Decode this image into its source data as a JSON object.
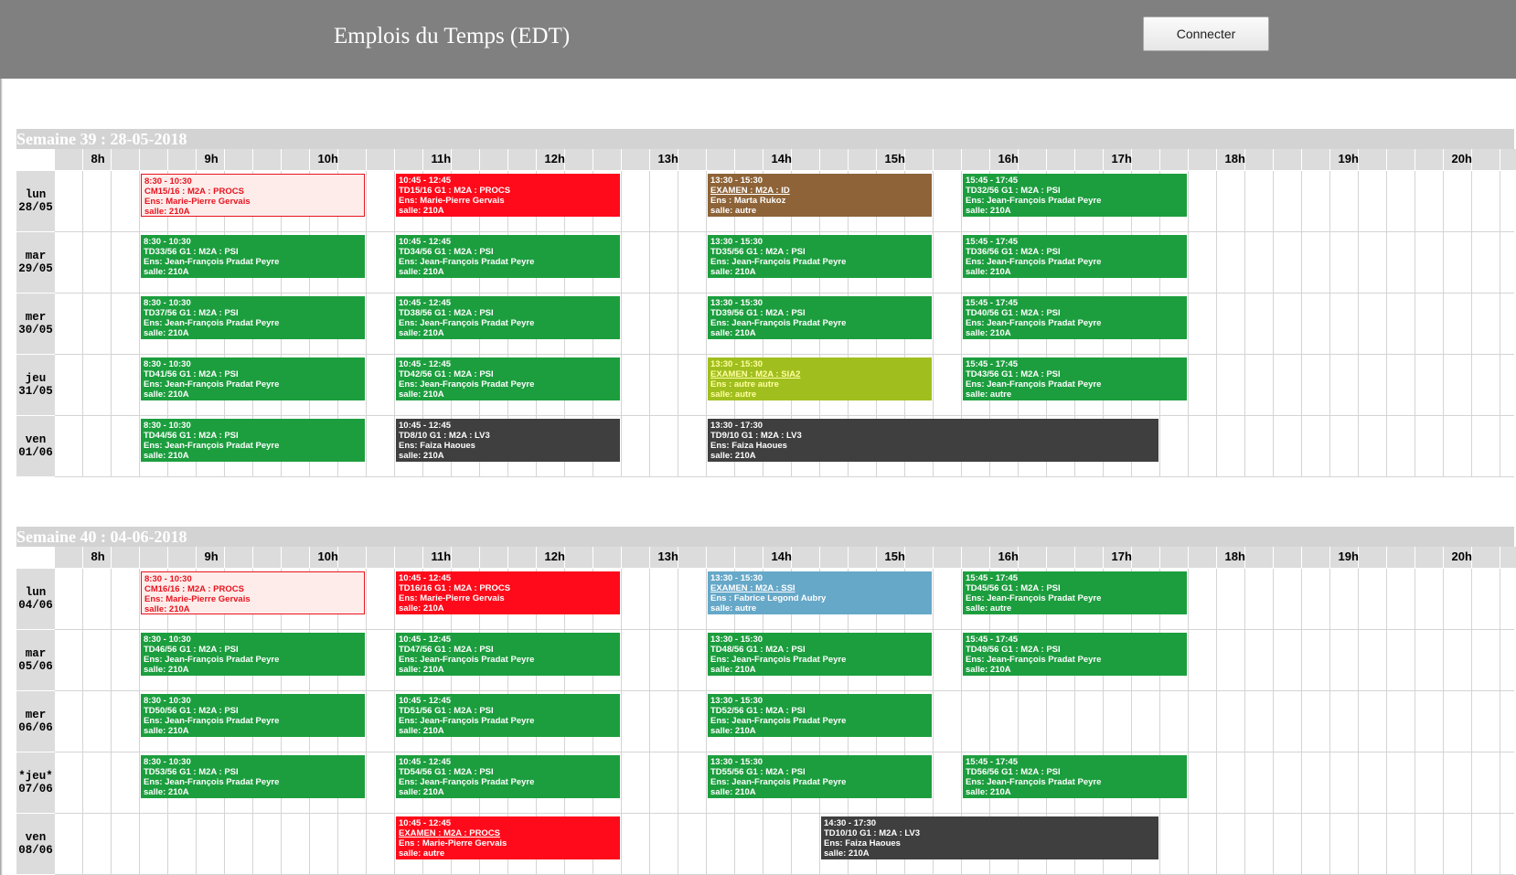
{
  "app": {
    "title": "Emplois du Temps (EDT)",
    "connect_label": "Connecter"
  },
  "hours": [
    "8h",
    "9h",
    "10h",
    "11h",
    "12h",
    "13h",
    "14h",
    "15h",
    "16h",
    "17h",
    "18h",
    "19h",
    "20h"
  ],
  "colors": {
    "CM": "#fdecea",
    "PROCS": "#ff0a1a",
    "PSI": "#1c9e3e",
    "ID": "#8d6337",
    "SIA2": "#a0bf1e",
    "LV3": "#3f3f3f",
    "SSI": "#66a8c8"
  },
  "weeks": [
    {
      "title": "Semaine 39 : 28-05-2018",
      "days": [
        {
          "name": "lun",
          "date": "28/05",
          "events": [
            {
              "start": "8:30",
              "end": "10:30",
              "time": "8:30 - 10:30",
              "title": "CM15/16 : M2A : PROCS",
              "teacher": "Ens: Marie-Pierre Gervais",
              "room": "salle: 210A",
              "kind": "cm"
            },
            {
              "start": "10:45",
              "end": "12:45",
              "time": "10:45 - 12:45",
              "title": "TD15/16 G1 : M2A : PROCS",
              "teacher": "Ens: Marie-Pierre Gervais",
              "room": "salle: 210A",
              "kind": "procs"
            },
            {
              "start": "13:30",
              "end": "15:30",
              "time": "13:30 - 15:30",
              "title": "EXAMEN : M2A : ID",
              "teacher": "Ens : Marta Rukoz",
              "room": "salle: autre",
              "kind": "id",
              "underline": true
            },
            {
              "start": "15:45",
              "end": "17:45",
              "time": "15:45 - 17:45",
              "title": "TD32/56 G1 : M2A : PSI",
              "teacher": "Ens: Jean-François Pradat Peyre",
              "room": "salle: 210A",
              "kind": "psi"
            }
          ]
        },
        {
          "name": "mar",
          "date": "29/05",
          "events": [
            {
              "start": "8:30",
              "end": "10:30",
              "time": "8:30 - 10:30",
              "title": "TD33/56 G1 : M2A : PSI",
              "teacher": "Ens: Jean-François Pradat Peyre",
              "room": "salle: 210A",
              "kind": "psi"
            },
            {
              "start": "10:45",
              "end": "12:45",
              "time": "10:45 - 12:45",
              "title": "TD34/56 G1 : M2A : PSI",
              "teacher": "Ens: Jean-François Pradat Peyre",
              "room": "salle: 210A",
              "kind": "psi"
            },
            {
              "start": "13:30",
              "end": "15:30",
              "time": "13:30 - 15:30",
              "title": "TD35/56 G1 : M2A : PSI",
              "teacher": "Ens: Jean-François Pradat Peyre",
              "room": "salle: 210A",
              "kind": "psi"
            },
            {
              "start": "15:45",
              "end": "17:45",
              "time": "15:45 - 17:45",
              "title": "TD36/56 G1 : M2A : PSI",
              "teacher": "Ens: Jean-François Pradat Peyre",
              "room": "salle: 210A",
              "kind": "psi"
            }
          ]
        },
        {
          "name": "mer",
          "date": "30/05",
          "events": [
            {
              "start": "8:30",
              "end": "10:30",
              "time": "8:30 - 10:30",
              "title": "TD37/56 G1 : M2A : PSI",
              "teacher": "Ens: Jean-François Pradat Peyre",
              "room": "salle: 210A",
              "kind": "psi"
            },
            {
              "start": "10:45",
              "end": "12:45",
              "time": "10:45 - 12:45",
              "title": "TD38/56 G1 : M2A : PSI",
              "teacher": "Ens: Jean-François Pradat Peyre",
              "room": "salle: 210A",
              "kind": "psi"
            },
            {
              "start": "13:30",
              "end": "15:30",
              "time": "13:30 - 15:30",
              "title": "TD39/56 G1 : M2A : PSI",
              "teacher": "Ens: Jean-François Pradat Peyre",
              "room": "salle: 210A",
              "kind": "psi"
            },
            {
              "start": "15:45",
              "end": "17:45",
              "time": "15:45 - 17:45",
              "title": "TD40/56 G1 : M2A : PSI",
              "teacher": "Ens: Jean-François Pradat Peyre",
              "room": "salle: 210A",
              "kind": "psi"
            }
          ]
        },
        {
          "name": "jeu",
          "date": "31/05",
          "events": [
            {
              "start": "8:30",
              "end": "10:30",
              "time": "8:30 - 10:30",
              "title": "TD41/56 G1 : M2A : PSI",
              "teacher": "Ens: Jean-François Pradat Peyre",
              "room": "salle: 210A",
              "kind": "psi"
            },
            {
              "start": "10:45",
              "end": "12:45",
              "time": "10:45 - 12:45",
              "title": "TD42/56 G1 : M2A : PSI",
              "teacher": "Ens: Jean-François Pradat Peyre",
              "room": "salle: 210A",
              "kind": "psi"
            },
            {
              "start": "13:30",
              "end": "15:30",
              "time": "13:30 - 15:30",
              "title": "EXAMEN : M2A : SIA2",
              "teacher": "Ens : autre autre",
              "room": "salle: autre",
              "kind": "sia2",
              "underline": true
            },
            {
              "start": "15:45",
              "end": "17:45",
              "time": "15:45 - 17:45",
              "title": "TD43/56 G1 : M2A : PSI",
              "teacher": "Ens: Jean-François Pradat Peyre",
              "room": "salle: autre",
              "kind": "psi"
            }
          ]
        },
        {
          "name": "ven",
          "date": "01/06",
          "events": [
            {
              "start": "8:30",
              "end": "10:30",
              "time": "8:30 - 10:30",
              "title": "TD44/56 G1 : M2A : PSI",
              "teacher": "Ens: Jean-François Pradat Peyre",
              "room": "salle: 210A",
              "kind": "psi"
            },
            {
              "start": "10:45",
              "end": "12:45",
              "time": "10:45 - 12:45",
              "title": "TD8/10 G1 : M2A : LV3",
              "teacher": "Ens: Faiza Haoues",
              "room": "salle: 210A",
              "kind": "lv3"
            },
            {
              "start": "13:30",
              "end": "17:30",
              "time": "13:30 - 17:30",
              "title": "TD9/10 G1 : M2A : LV3",
              "teacher": "Ens: Faiza Haoues",
              "room": "salle: 210A",
              "kind": "lv3"
            }
          ]
        }
      ]
    },
    {
      "title": "Semaine 40 : 04-06-2018",
      "days": [
        {
          "name": "lun",
          "date": "04/06",
          "events": [
            {
              "start": "8:30",
              "end": "10:30",
              "time": "8:30 - 10:30",
              "title": "CM16/16 : M2A : PROCS",
              "teacher": "Ens: Marie-Pierre Gervais",
              "room": "salle: 210A",
              "kind": "cm"
            },
            {
              "start": "10:45",
              "end": "12:45",
              "time": "10:45 - 12:45",
              "title": "TD16/16 G1 : M2A : PROCS",
              "teacher": "Ens: Marie-Pierre Gervais",
              "room": "salle: 210A",
              "kind": "procs"
            },
            {
              "start": "13:30",
              "end": "15:30",
              "time": "13:30 - 15:30",
              "title": "EXAMEN : M2A : SSI",
              "teacher": "Ens : Fabrice Legond Aubry",
              "room": "salle: autre",
              "kind": "ssi",
              "underline": true
            },
            {
              "start": "15:45",
              "end": "17:45",
              "time": "15:45 - 17:45",
              "title": "TD45/56 G1 : M2A : PSI",
              "teacher": "Ens: Jean-François Pradat Peyre",
              "room": "salle: autre",
              "kind": "psi"
            }
          ]
        },
        {
          "name": "mar",
          "date": "05/06",
          "events": [
            {
              "start": "8:30",
              "end": "10:30",
              "time": "8:30 - 10:30",
              "title": "TD46/56 G1 : M2A : PSI",
              "teacher": "Ens: Jean-François Pradat Peyre",
              "room": "salle: 210A",
              "kind": "psi"
            },
            {
              "start": "10:45",
              "end": "12:45",
              "time": "10:45 - 12:45",
              "title": "TD47/56 G1 : M2A : PSI",
              "teacher": "Ens: Jean-François Pradat Peyre",
              "room": "salle: 210A",
              "kind": "psi"
            },
            {
              "start": "13:30",
              "end": "15:30",
              "time": "13:30 - 15:30",
              "title": "TD48/56 G1 : M2A : PSI",
              "teacher": "Ens: Jean-François Pradat Peyre",
              "room": "salle: 210A",
              "kind": "psi"
            },
            {
              "start": "15:45",
              "end": "17:45",
              "time": "15:45 - 17:45",
              "title": "TD49/56 G1 : M2A : PSI",
              "teacher": "Ens: Jean-François Pradat Peyre",
              "room": "salle: 210A",
              "kind": "psi"
            }
          ]
        },
        {
          "name": "mer",
          "date": "06/06",
          "events": [
            {
              "start": "8:30",
              "end": "10:30",
              "time": "8:30 - 10:30",
              "title": "TD50/56 G1 : M2A : PSI",
              "teacher": "Ens: Jean-François Pradat Peyre",
              "room": "salle: 210A",
              "kind": "psi"
            },
            {
              "start": "10:45",
              "end": "12:45",
              "time": "10:45 - 12:45",
              "title": "TD51/56 G1 : M2A : PSI",
              "teacher": "Ens: Jean-François Pradat Peyre",
              "room": "salle: 210A",
              "kind": "psi"
            },
            {
              "start": "13:30",
              "end": "15:30",
              "time": "13:30 - 15:30",
              "title": "TD52/56 G1 : M2A : PSI",
              "teacher": "Ens: Jean-François Pradat Peyre",
              "room": "salle: 210A",
              "kind": "psi"
            }
          ]
        },
        {
          "name": "*jeu*",
          "date": "07/06",
          "events": [
            {
              "start": "8:30",
              "end": "10:30",
              "time": "8:30 - 10:30",
              "title": "TD53/56 G1 : M2A : PSI",
              "teacher": "Ens: Jean-François Pradat Peyre",
              "room": "salle: 210A",
              "kind": "psi"
            },
            {
              "start": "10:45",
              "end": "12:45",
              "time": "10:45 - 12:45",
              "title": "TD54/56 G1 : M2A : PSI",
              "teacher": "Ens: Jean-François Pradat Peyre",
              "room": "salle: 210A",
              "kind": "psi"
            },
            {
              "start": "13:30",
              "end": "15:30",
              "time": "13:30 - 15:30",
              "title": "TD55/56 G1 : M2A : PSI",
              "teacher": "Ens: Jean-François Pradat Peyre",
              "room": "salle: 210A",
              "kind": "psi"
            },
            {
              "start": "15:45",
              "end": "17:45",
              "time": "15:45 - 17:45",
              "title": "TD56/56 G1 : M2A : PSI",
              "teacher": "Ens: Jean-François Pradat Peyre",
              "room": "salle: 210A",
              "kind": "psi"
            }
          ]
        },
        {
          "name": "ven",
          "date": "08/06",
          "events": [
            {
              "start": "10:45",
              "end": "12:45",
              "time": "10:45 - 12:45",
              "title": "EXAMEN : M2A : PROCS",
              "teacher": "Ens : Marie-Pierre Gervais",
              "room": "salle: autre",
              "kind": "procs",
              "underline": true
            },
            {
              "start": "14:30",
              "end": "17:30",
              "time": "14:30 - 17:30",
              "title": "TD10/10 G1 : M2A : LV3",
              "teacher": "Ens: Faiza Haoues",
              "room": "salle: 210A",
              "kind": "lv3"
            }
          ]
        }
      ]
    }
  ]
}
